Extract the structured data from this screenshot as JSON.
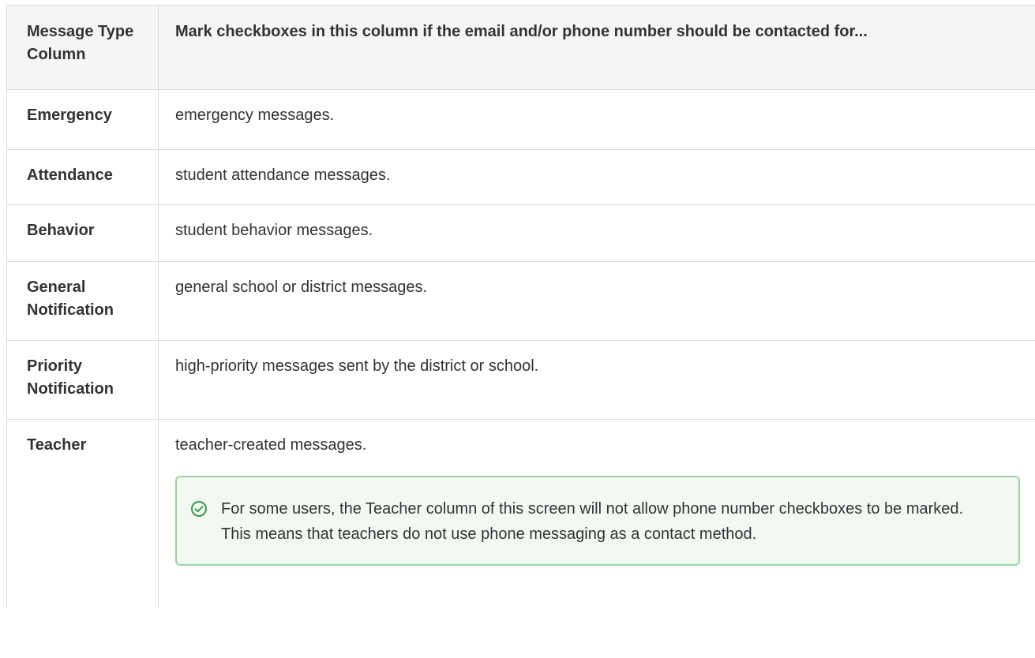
{
  "table": {
    "headers": {
      "type_col": "Message Type Column",
      "desc_col": "Mark checkboxes in this column if the email and/or phone number should be contacted for..."
    },
    "rows": [
      {
        "type": "Emergency",
        "description": "emergency messages."
      },
      {
        "type": "Attendance",
        "description": "student attendance messages."
      },
      {
        "type": "Behavior",
        "description": "student behavior messages."
      },
      {
        "type": "General Notification",
        "description": "general school or district messages."
      },
      {
        "type": "Priority Notification",
        "description": "high-priority messages sent by the district or school."
      },
      {
        "type": "Teacher",
        "description": "teacher-created messages."
      }
    ]
  },
  "note": {
    "icon": "check-circle-icon",
    "text": "For some users, the Teacher column of this screen will not allow phone number checkboxes to be marked. This means that teachers do not use phone messaging as a contact method."
  },
  "colors": {
    "note_border": "#9ed3a6",
    "note_background": "#f2f9f3",
    "icon_color": "#3a9a4a",
    "header_background": "#f5f5f5",
    "border": "#dddddd"
  }
}
